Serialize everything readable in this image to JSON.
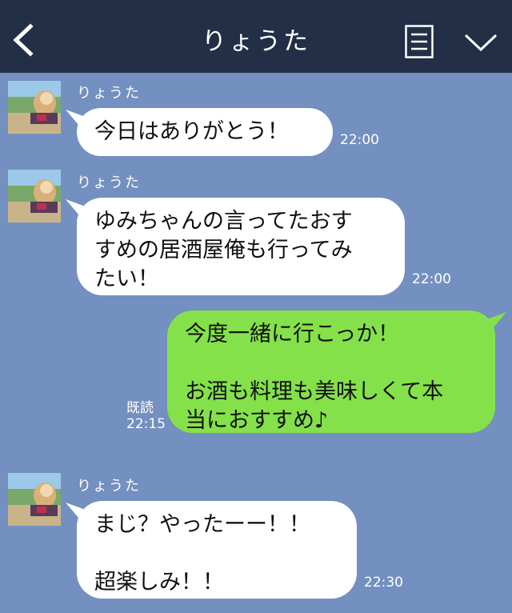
{
  "header": {
    "title": "りょうた",
    "back_icon": "chevron-left-icon",
    "menu_icon": "menu-icon",
    "more_icon": "chevron-down-icon",
    "background": "#232f47"
  },
  "chat": {
    "background": "#7490c0",
    "messages": [
      {
        "sender": "りょうた",
        "text": "今日はありがとう！",
        "time": "22:00",
        "side": "left"
      },
      {
        "sender": "りょうた",
        "text": "ゆみちゃんの言ってたおす\nすめの居酒屋俺も行ってみ\nたい！",
        "time": "22:00",
        "side": "left"
      },
      {
        "text": "今度一緒に行こっか！\n\nお酒も料理も美味しくて本\n当におすすめ♪",
        "time": "22:15",
        "read": "既読",
        "side": "right"
      },
      {
        "sender": "りょうた",
        "text": "まじ？やったーー！！\n\n超楽しみ！！",
        "time": "22:30",
        "side": "left"
      }
    ]
  },
  "colors": {
    "bubble_left": "#ffffff",
    "bubble_right": "#84e14a"
  }
}
